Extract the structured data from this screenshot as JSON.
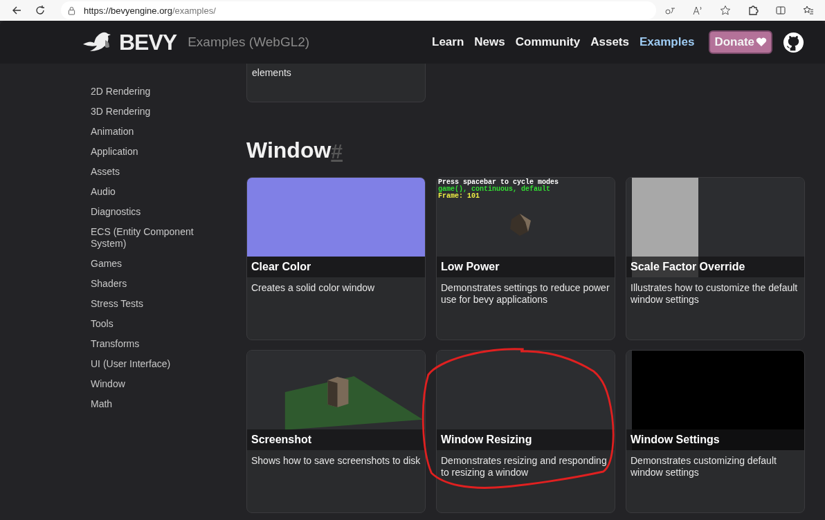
{
  "browser": {
    "url_host": "https://bevyengine.org",
    "url_path": "/examples/"
  },
  "header": {
    "logo": "BEVY",
    "subtitle": "Examples (WebGL2)",
    "nav": [
      {
        "label": "Learn",
        "selected": false
      },
      {
        "label": "News",
        "selected": false
      },
      {
        "label": "Community",
        "selected": false
      },
      {
        "label": "Assets",
        "selected": false
      },
      {
        "label": "Examples",
        "selected": true
      }
    ],
    "donate": "Donate"
  },
  "sidebar": {
    "items": [
      "2D Rendering",
      "3D Rendering",
      "Animation",
      "Application",
      "Assets",
      "Audio",
      "Diagnostics",
      "ECS (Entity Component System)",
      "Games",
      "Shaders",
      "Stress Tests",
      "Tools",
      "Transforms",
      "UI (User Interface)",
      "Window",
      "Math"
    ]
  },
  "previous_card": {
    "description": "elements"
  },
  "section": {
    "title": "Window",
    "anchor": "#"
  },
  "cards": [
    {
      "title": "Clear Color",
      "description": "Creates a solid color window",
      "thumb": {
        "kind": "solid",
        "color": "#8080e6"
      }
    },
    {
      "title": "Low Power",
      "description": "Demonstrates settings to reduce power use for bevy applications",
      "thumb": {
        "kind": "cube",
        "lines": [
          {
            "text": "Press spacebar to cycle modes",
            "color": "#ffffff"
          },
          {
            "text": "game(), continuous, default",
            "color": "#33dd33"
          },
          {
            "text": "Frame: 101",
            "color": "#eeee44"
          }
        ]
      }
    },
    {
      "title": "Scale Factor Override",
      "description": "Illustrates how to customize the default window settings",
      "thumb": {
        "kind": "panel"
      }
    },
    {
      "title": "Screenshot",
      "description": "Shows how to save screenshots to disk",
      "thumb": {
        "kind": "plane"
      }
    },
    {
      "title": "Window Resizing",
      "description": "Demonstrates resizing and responding to resizing a window",
      "thumb": {
        "kind": "blank"
      }
    },
    {
      "title": "Window Settings",
      "description": "Demonstrates customizing default window settings",
      "thumb": {
        "kind": "black"
      }
    }
  ]
}
